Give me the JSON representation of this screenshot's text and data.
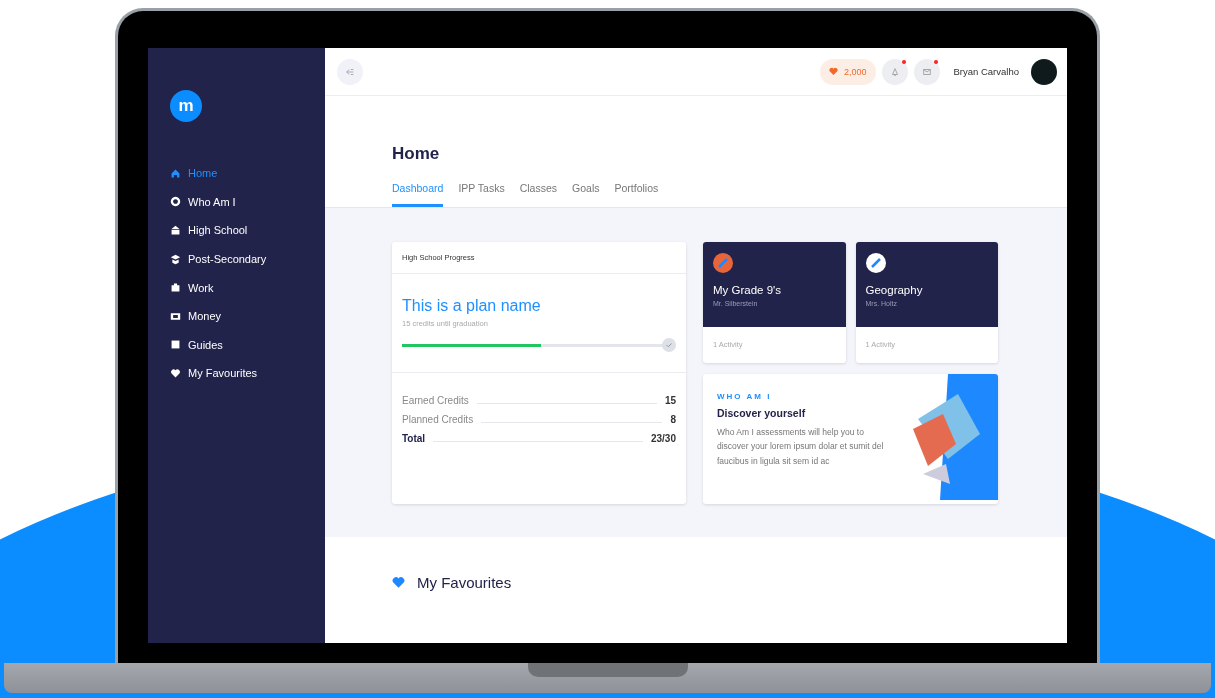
{
  "sidebar": {
    "logo": "m",
    "items": [
      {
        "label": "Home",
        "selected": true
      },
      {
        "label": "Who Am I",
        "selected": false
      },
      {
        "label": "High School",
        "selected": false
      },
      {
        "label": "Post-Secondary",
        "selected": false
      },
      {
        "label": "Work",
        "selected": false
      },
      {
        "label": "Money",
        "selected": false
      },
      {
        "label": "Guides",
        "selected": false
      },
      {
        "label": "My Favourites",
        "selected": false
      }
    ]
  },
  "topbar": {
    "points": "2,000",
    "notifications_unread": true,
    "messages_unread": true,
    "user_name": "Bryan Carvalho"
  },
  "page": {
    "title": "Home",
    "tabs": [
      {
        "label": "Dashboard",
        "selected": true
      },
      {
        "label": "IPP Tasks",
        "selected": false
      },
      {
        "label": "Classes",
        "selected": false
      },
      {
        "label": "Goals",
        "selected": false
      },
      {
        "label": "Portfolios",
        "selected": false
      }
    ]
  },
  "progress_card": {
    "header": "High School Progress",
    "plan_name": "This is a plan name",
    "subtitle": "15 credits until graduation",
    "level": 0.53,
    "rows": [
      {
        "label": "Earned Credits",
        "value": "15",
        "total": false
      },
      {
        "label": "Planned Credits",
        "value": "8",
        "total": false
      },
      {
        "label": "Total",
        "value": "23/30",
        "total": true
      }
    ]
  },
  "class_cards": [
    {
      "title": "My Grade 9's",
      "teacher": "Mr. Silberstein",
      "activity": "1 Activity",
      "color": "#e8643a"
    },
    {
      "title": "Geography",
      "teacher": "Mrs. Holtz",
      "activity": "1 Activity",
      "color": "#ffffff"
    }
  ],
  "promo_card": {
    "eyebrow": "WHO AM I",
    "title": "Discover yourself",
    "body": "Who Am I assessments will help you to discover your lorem ipsum dolar et sumit del faucibus in ligula sit sem id ac"
  },
  "favourites": {
    "title": "My Favourites"
  }
}
